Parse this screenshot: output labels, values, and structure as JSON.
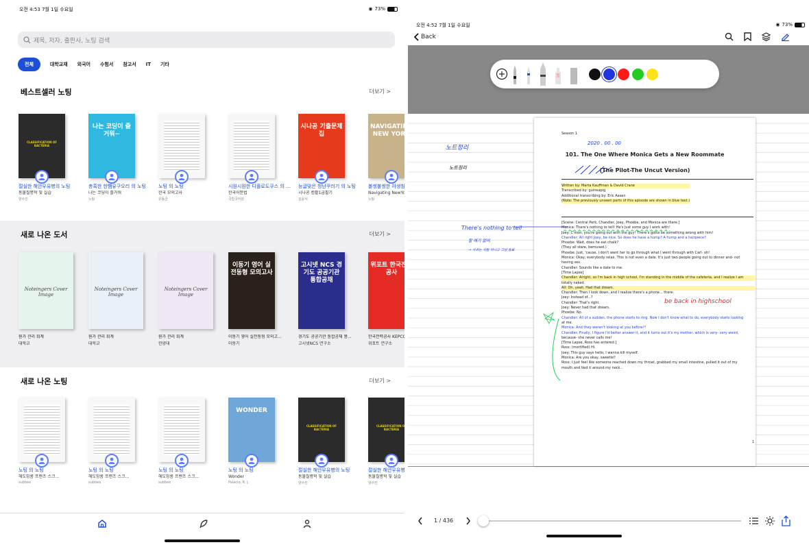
{
  "left": {
    "status": {
      "time": "오전 4:53",
      "date": "7월 1일 수요일",
      "battery": "73%"
    },
    "search": {
      "placeholder": "제목, 저자, 출판사, 노팅 검색"
    },
    "categories": [
      "전체",
      "대학교재",
      "외국어",
      "수험서",
      "참고서",
      "IT",
      "기타"
    ],
    "sections": [
      {
        "title": "베스트셀러 노팅",
        "more": "더보기 >"
      },
      {
        "title": "새로 나온 도서",
        "more": "더보기 >"
      },
      {
        "title": "새로 나온 노팅",
        "more": "더보기 >"
      }
    ],
    "bestsellers": [
      {
        "title": "절실한 해안우유병의 노팅",
        "sub": "동물질병학 및 실습",
        "user": "양수진",
        "cover_color": "#2b2b2b",
        "cover_text": "CLASSIFICATION OF BACTERIA"
      },
      {
        "title": "총혹한 한뺌유구오리 의 노팅",
        "sub": "나는 코딩이 즐거워",
        "user": "노팅",
        "cover_color": "#30b9e0",
        "cover_text": "나는 코딩이 즐거워~"
      },
      {
        "title": "노팅 의 노팅",
        "sub": "한국 모의고사",
        "user": "유동균",
        "cover_color": "#f7f7f7",
        "cover_text": ""
      },
      {
        "title": "시원시원한 디플로도쿠스 의 노팅",
        "sub": "한국어문법",
        "user": "국립국어원",
        "cover_color": "#f7f7f7",
        "cover_text": ""
      },
      {
        "title": "능글맞은 청난꾸러기 의 노팅",
        "sub": "시나공 컴활1급필기",
        "user": "김윤식",
        "cover_color": "#e53b1c",
        "cover_text": "시나공 기출문제집"
      },
      {
        "title": "볼썽불썽한 아생침 면조 의 노팅",
        "sub": "Navigating NewYork",
        "user": "노팅",
        "cover_color": "#c8b28a",
        "cover_text": "NAVIGATING NEW YORK"
      }
    ],
    "new_books": [
      {
        "title": "원가 관리 회계",
        "sub": "대학교",
        "cover_color": "#e6f4ee",
        "cover_text": "Noteingers Cover Image"
      },
      {
        "title": "원가 관리 회계",
        "sub": "대학교",
        "cover_color": "#eaf0f7",
        "cover_text": "Noteingers Cover Image"
      },
      {
        "title": "원가 관리 회계",
        "sub": "한양대",
        "cover_color": "#f0e8f4",
        "cover_text": "Noteingers Cover Image"
      },
      {
        "title": "이동기 영어 실전동형 모의고...",
        "sub": "이동기",
        "cover_color": "#2a2118",
        "cover_text": "이동기 영어 실전동형 모의고사"
      },
      {
        "title": "경기도 공공기관 통합공채 봉...",
        "sub": "고시넷NCS 연구소",
        "cover_color": "#2a2d8c",
        "cover_text": "고시넷 NCS 경기도 공공기관 통합공채"
      },
      {
        "title": "한국전력공사 KEPCO",
        "sub": "위포트 연구소",
        "cover_color": "#e42b26",
        "cover_text": "위포트 한국전력공사"
      }
    ],
    "new_notes": [
      {
        "title": "노팅 의 노팅",
        "sub": "헤도밍룡 프랜츠 스크...",
        "user": "subbee",
        "cover_color": "#f8f8f8",
        "cover_text": ""
      },
      {
        "title": "노팅 의 노팅",
        "sub": "헤도밍룡 프랜츠 스크...",
        "user": "subbee",
        "cover_color": "#f8f8f8",
        "cover_text": ""
      },
      {
        "title": "노팅 의 노팅",
        "sub": "헤도밍룡 프랜츠 스크...",
        "user": "subbee",
        "cover_color": "#f8f8f8",
        "cover_text": ""
      },
      {
        "title": "노팅 의 노팅",
        "sub": "Wonder",
        "user": "Palacio, R. J.",
        "cover_color": "#6fa8d8",
        "cover_text": "WONDER"
      },
      {
        "title": "절실한 해안우유병의 노팅",
        "sub": "동물질병학 및 실습",
        "user": "양수진",
        "cover_color": "#2b2b2b",
        "cover_text": "CLASSIFICATION OF BACTERIA"
      },
      {
        "title": "절실한 해안우유병의 노팅",
        "sub": "동물질병학 및 실습",
        "user": "양수진",
        "cover_color": "#2b2b2b",
        "cover_text": "CLASSIFICATION OF BACTERIA"
      }
    ],
    "tabbar": [
      "home-icon",
      "feather-icon",
      "person-icon"
    ]
  },
  "right": {
    "status": {
      "time": "오전 4:52",
      "date": "7월 1일 수요일",
      "battery": "73%"
    },
    "back": "Back",
    "colors": [
      "#111111",
      "#1d34e0",
      "#ff1a1a",
      "#22cc22",
      "#ffe21a"
    ],
    "doc": {
      "season": "Season 1",
      "date_note": "2020 . 00 . 00",
      "title": "101. The One Where Monica Gets a New Roommate",
      "subtitle": "(The Pilot-The Uncut Version)",
      "credits": [
        "Written by: Marta Kauffman & David Crane",
        "Transcribed by: guineapig",
        "Additional transcribing by: Eric Aasen",
        "(Note: The previously unseen parts of this episode are shown in blue text.)"
      ],
      "lines": [
        "[Scene: Central Perk, Chandler, Joey, Phoebe, and Monica are there.]",
        "Monica: There's nothing to tell! He's just some guy I work with!",
        "Joey: C'mon, you're going out with the guy! There's gotta be something wrong with him!",
        "Chandler: All right Joey, be nice.  So does he have a hump? A hump and a hairpiece?",
        "Phoebe: Wait, does he eat chalk?",
        "(They all stare, bemused.)",
        "Phoebe: Just, 'cause, I don't want her to go through what I went through with Carl- oh!",
        "Monica: Okay, everybody relax. This is not even a date. It's just two people going out to dinner and- not",
        "having sex.",
        "Chandler: Sounds like a date to me.",
        "[Time Lapse]",
        "Chandler: Alright, so I'm back in high school, I'm standing in the middle of the cafeteria, and I realize I am",
        "totally naked.",
        "All: Oh, yeah. Had that dream.",
        "Chandler: Then I look down, and I realize there's a phone... there.",
        "Joey: Instead of...?",
        "Chandler: That's right.",
        "Joey: Never had that dream.",
        "Phoebe: No.",
        "Chandler: All of a sudden, the phone starts to ring. Now I don't know what to do, everybody starts looking",
        "at me.",
        "Monica: And they weren't looking at you before?!",
        "Chandler: Finally, I figure I'd better answer it, and it turns out it's my mother, which is very- very weird,",
        "because- she never calls me!",
        "[Time Lapse, Ross has entered.]",
        "Ross: (mortified) Hi.",
        "Joey: This guy says hello, I wanna kill myself.",
        "Monica: Are you okay, sweetie?",
        "Ross: I just feel like someone reached down my throat, grabbed my small intestine, pulled it out of my",
        "mouth and tied it around my neck..."
      ],
      "page_no": "1",
      "notes": {
        "left1": "노트정리",
        "left2": "노트정리",
        "tell": "There's nothing to tell",
        "tell2": "할 얘기 없어.",
        "tell3": "→ 사귀는 사람 아니고 그냥 동료",
        "highschool": "be back in highschool"
      }
    },
    "pager": {
      "label": "1 / 436"
    }
  }
}
